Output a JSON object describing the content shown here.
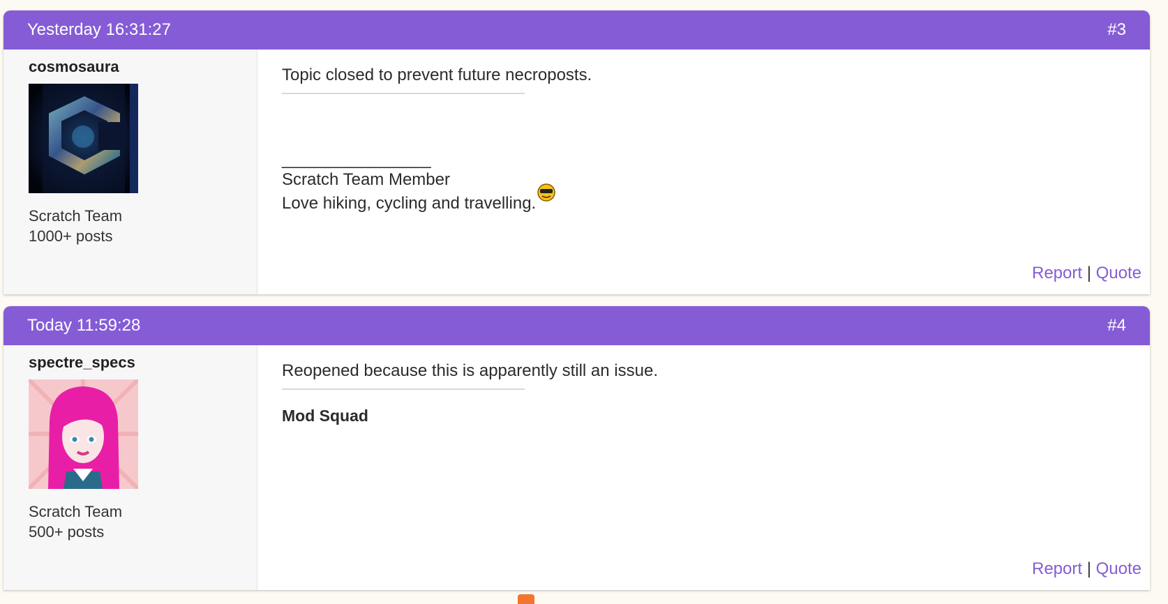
{
  "posts": [
    {
      "timestamp": "Yesterday 16:31:27",
      "number": "#3",
      "username": "cosmosaura",
      "rank": "Scratch Team",
      "post_count": "1000+ posts",
      "message": "Topic closed to prevent future necroposts.",
      "signature": {
        "line": "________________",
        "title": "Scratch Team Member",
        "text": "Love hiking, cycling and travelling.",
        "emoji": "cool-smiley-icon"
      },
      "actions": {
        "report": "Report",
        "separator": "|",
        "quote": "Quote"
      }
    },
    {
      "timestamp": "Today 11:59:28",
      "number": "#4",
      "username": "spectre_specs",
      "rank": "Scratch Team",
      "post_count": "500+ posts",
      "message": "Reopened because this is apparently still an issue.",
      "signature": {
        "title": "Mod Squad"
      },
      "actions": {
        "report": "Report",
        "separator": "|",
        "quote": "Quote"
      }
    }
  ],
  "colors": {
    "accent": "#855cd6",
    "page_bg": "#fcfaf2",
    "sidebar_bg": "#f7f7f8"
  }
}
